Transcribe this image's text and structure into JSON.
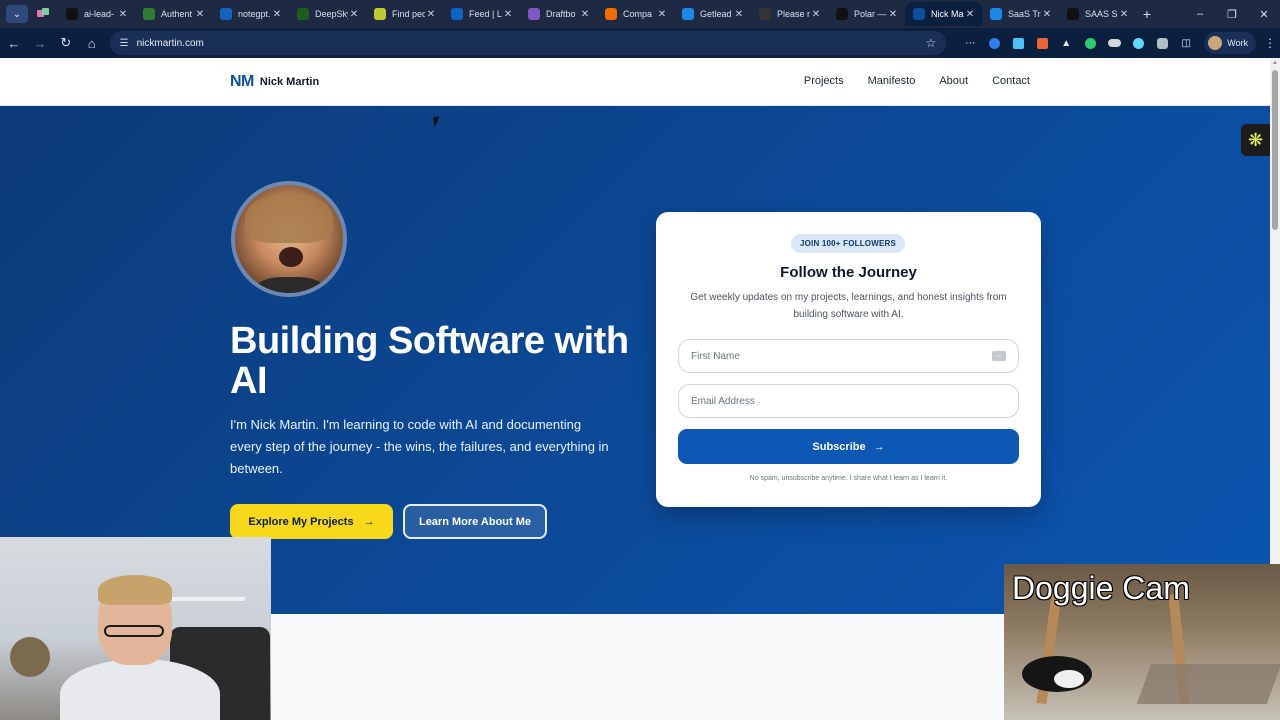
{
  "browser": {
    "tabs": [
      {
        "title": "ai-lead-",
        "icon": "triangle-icon",
        "color": "#111111"
      },
      {
        "title": "Authent",
        "icon": "pulse-icon",
        "color": "#2e7d32"
      },
      {
        "title": "notegpt.",
        "icon": "globe-icon",
        "color": "#1565c0"
      },
      {
        "title": "DeepSky",
        "icon": "chart-icon",
        "color": "#1b5e20"
      },
      {
        "title": "Find pec",
        "icon": "grid-icon",
        "color": "#c0ca33"
      },
      {
        "title": "Feed | Li",
        "icon": "linkedin-icon",
        "color": "#0a66c2"
      },
      {
        "title": "Draftbo",
        "icon": "sparkle-icon",
        "color": "#7e57c2"
      },
      {
        "title": "Compa",
        "icon": "chrome-icon",
        "color": "#ef6c00"
      },
      {
        "title": "Getlead",
        "icon": "g-icon",
        "color": "#1e88e5"
      },
      {
        "title": "Please r",
        "icon": "square-icon",
        "color": "#333333"
      },
      {
        "title": "Polar —",
        "icon": "circle-icon",
        "color": "#111111"
      },
      {
        "title": "Nick Ma",
        "icon": "nm-icon",
        "color": "#0d4f9e",
        "active": true
      },
      {
        "title": "SaaS Tra",
        "icon": "arrow-icon",
        "color": "#1e88e5"
      },
      {
        "title": "SAAS Si",
        "icon": "triangle-icon",
        "color": "#111111"
      }
    ],
    "url": "nickmartin.com",
    "profile_label": "Work"
  },
  "site": {
    "logo_mark": "NM",
    "logo_name": "Nick Martin",
    "nav": [
      "Projects",
      "Manifesto",
      "About",
      "Contact"
    ]
  },
  "hero": {
    "title": "Building Software with AI",
    "subtitle": "I'm Nick Martin. I'm learning to code with AI and documenting every step of the journey - the wins, the failures, and everything in between.",
    "primary_cta": "Explore My Projects",
    "secondary_cta": "Learn More About Me"
  },
  "signup": {
    "badge": "JOIN 100+ FOLLOWERS",
    "title": "Follow the Journey",
    "description": "Get weekly updates on my projects, learnings, and honest insights from building software with AI.",
    "first_name_placeholder": "First Name",
    "email_placeholder": "Email Address",
    "submit_label": "Subscribe",
    "note": "No spam, unsubscribe anytime. I share what I learn as I learn it."
  },
  "overlay": {
    "dog_cam_label": "Doggie Cam"
  },
  "colors": {
    "brand_blue": "#0d4f9e",
    "cta_yellow": "#f7d91a",
    "hero_bg": "#0c4a99"
  }
}
